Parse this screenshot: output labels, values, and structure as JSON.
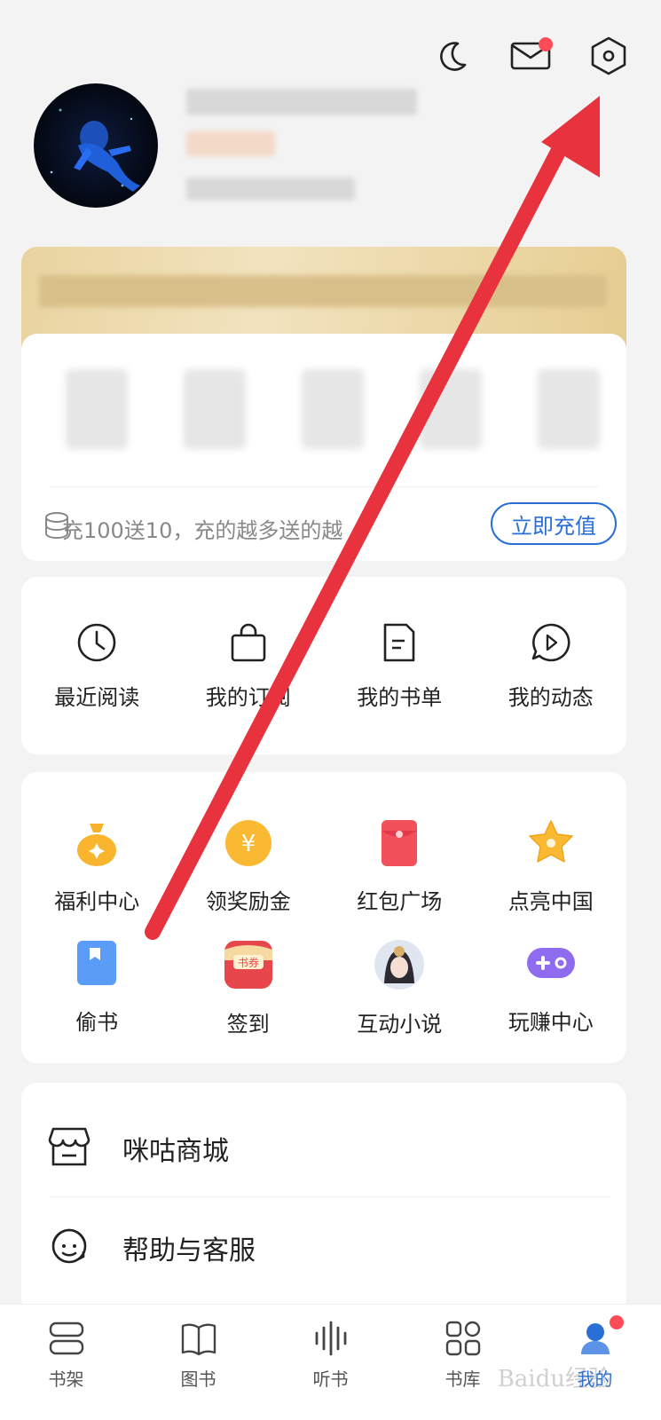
{
  "header": {
    "night_mode_icon": "moon-icon",
    "messages_icon": "mail-icon",
    "settings_icon": "settings-hexagon-icon"
  },
  "recharge": {
    "promo_text": "充100送10，充的越多送的越",
    "button_label": "立即充值"
  },
  "quick_actions": [
    {
      "label": "最近阅读",
      "icon": "clock-icon"
    },
    {
      "label": "我的订阅",
      "icon": "bag-icon"
    },
    {
      "label": "我的书单",
      "icon": "document-icon"
    },
    {
      "label": "我的动态",
      "icon": "play-bubble-icon"
    }
  ],
  "features": [
    {
      "label": "福利中心",
      "icon": "money-bag-icon"
    },
    {
      "label": "领奖励金",
      "icon": "yuan-coin-icon"
    },
    {
      "label": "红包广场",
      "icon": "red-envelope-icon"
    },
    {
      "label": "点亮中国",
      "icon": "star-icon"
    },
    {
      "label": "偷书",
      "icon": "bookmark-book-icon"
    },
    {
      "label": "签到",
      "icon": "coupon-icon"
    },
    {
      "label": "互动小说",
      "icon": "character-avatar-icon"
    },
    {
      "label": "玩赚中心",
      "icon": "gamepad-icon"
    }
  ],
  "menu": [
    {
      "label": "咪咕商城",
      "icon": "store-icon"
    },
    {
      "label": "帮助与客服",
      "icon": "customer-service-icon"
    }
  ],
  "tabs": [
    {
      "label": "书架",
      "icon": "bookshelf-icon"
    },
    {
      "label": "图书",
      "icon": "book-icon"
    },
    {
      "label": "听书",
      "icon": "audio-wave-icon"
    },
    {
      "label": "书库",
      "icon": "grid-icon"
    },
    {
      "label": "我的",
      "icon": "profile-icon",
      "active": true
    }
  ],
  "watermark": "Baidu经验",
  "colors": {
    "accent": "#2a6fd6",
    "badge": "#ff4d57",
    "arrow": "#e8333f"
  }
}
